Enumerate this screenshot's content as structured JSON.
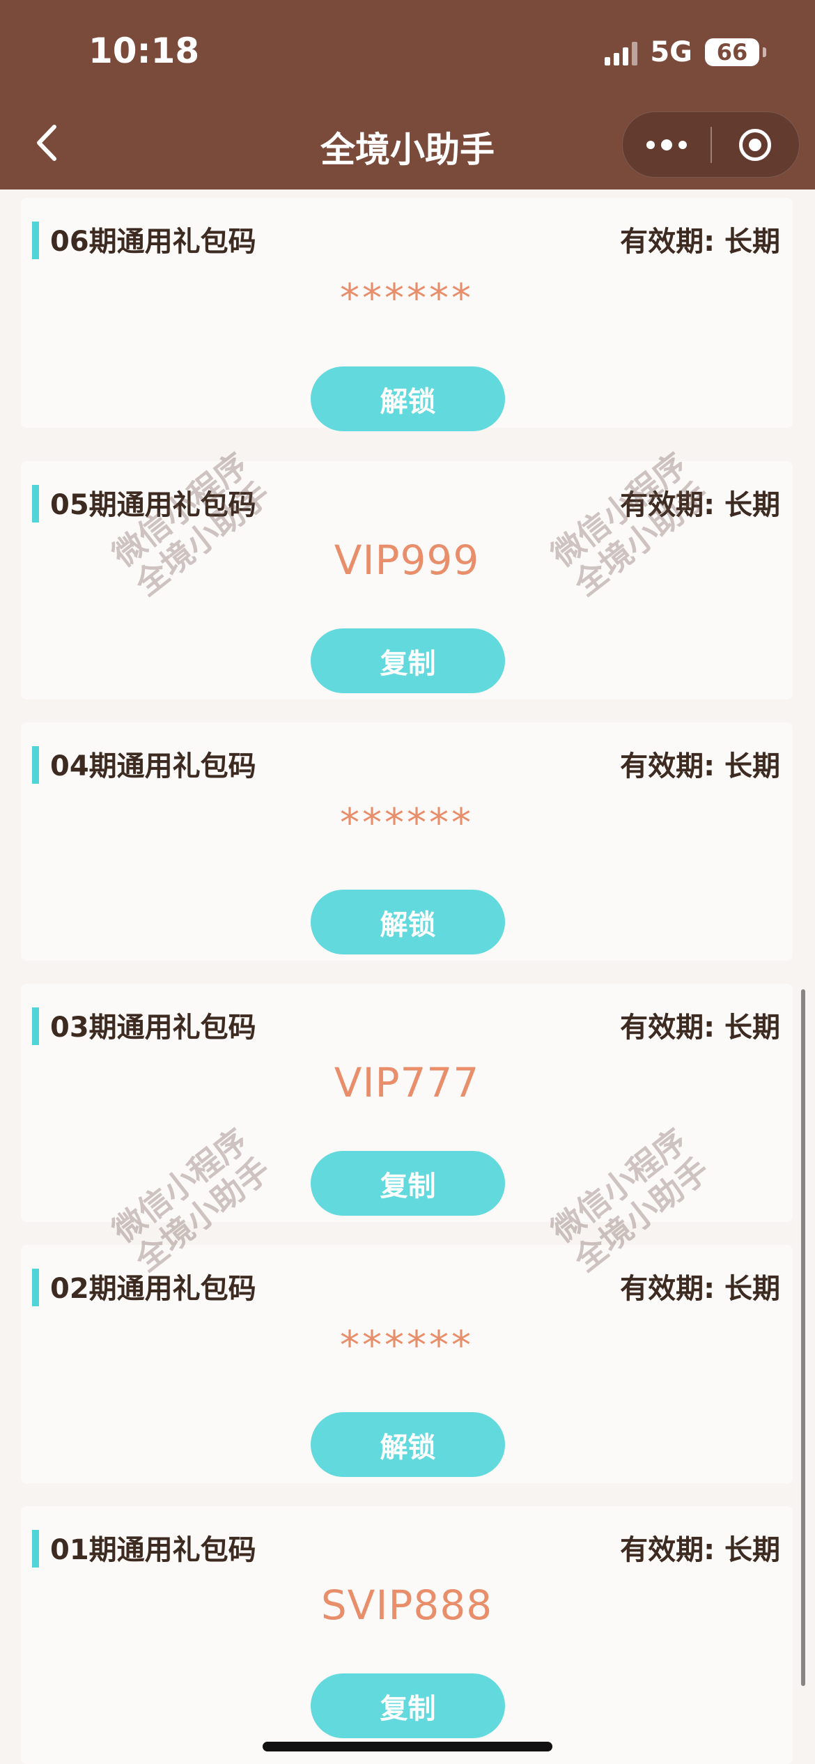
{
  "status_bar": {
    "time": "10:18",
    "network": "5G",
    "battery": "66"
  },
  "nav": {
    "title": "全境小助手"
  },
  "colors": {
    "header_bg": "#7a4a3a",
    "accent": "#62d9dc",
    "code_color": "#e88e6a",
    "text": "#3d2b22"
  },
  "cards": [
    {
      "title": "06期通用礼包码",
      "validity": "有效期: 长期",
      "code": "******",
      "button": "解锁"
    },
    {
      "title": "05期通用礼包码",
      "validity": "有效期: 长期",
      "code": "VIP999",
      "button": "复制"
    },
    {
      "title": "04期通用礼包码",
      "validity": "有效期: 长期",
      "code": "******",
      "button": "解锁"
    },
    {
      "title": "03期通用礼包码",
      "validity": "有效期: 长期",
      "code": "VIP777",
      "button": "复制"
    },
    {
      "title": "02期通用礼包码",
      "validity": "有效期: 长期",
      "code": "******",
      "button": "解锁"
    },
    {
      "title": "01期通用礼包码",
      "validity": "有效期: 长期",
      "code": "SVIP888",
      "button": "复制"
    }
  ],
  "watermarks": [
    {
      "line1": "微信小程序",
      "line2": "全境小助手"
    },
    {
      "line1": "微信小程序",
      "line2": "全境小助手"
    },
    {
      "line1": "微信小程序",
      "line2": "全境小助手"
    },
    {
      "line1": "微信小程序",
      "line2": "全境小助手"
    }
  ]
}
